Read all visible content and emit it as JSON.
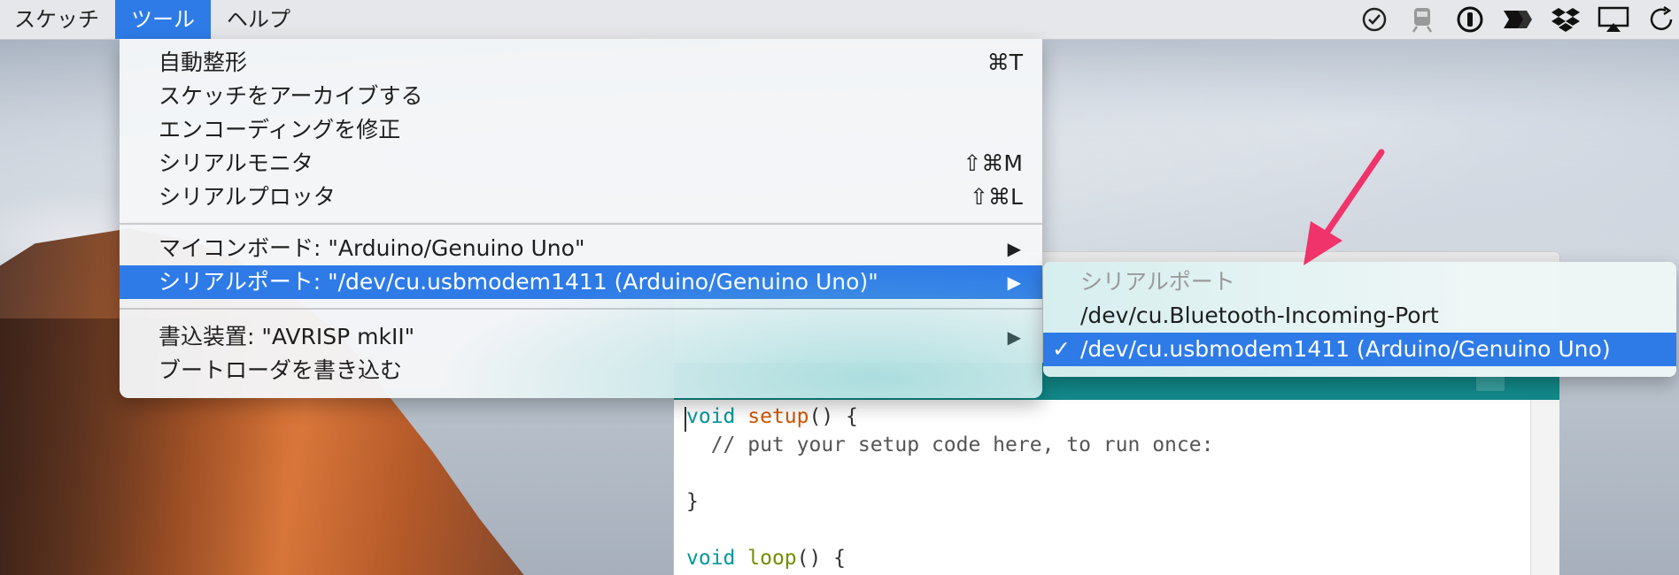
{
  "menubar": {
    "items": [
      {
        "label": "スケッチ"
      },
      {
        "label": "ツール"
      },
      {
        "label": "ヘルプ"
      }
    ],
    "status_icons": [
      "check-badge-icon",
      "train-icon",
      "one-password-icon",
      "arrows-icon",
      "dropbox-icon",
      "airplay-icon",
      "sync-icon"
    ]
  },
  "tools_menu": {
    "items": [
      {
        "label": "自動整形",
        "shortcut": "⌘T"
      },
      {
        "label": "スケッチをアーカイブする",
        "shortcut": ""
      },
      {
        "label": "エンコーディングを修正",
        "shortcut": ""
      },
      {
        "label": "シリアルモニタ",
        "shortcut": "⇧⌘M"
      },
      {
        "label": "シリアルプロッタ",
        "shortcut": "⇧⌘L"
      },
      {
        "label": "マイコンボード: \"Arduino/Genuino Uno\"",
        "submenu": true
      },
      {
        "label": "シリアルポート: \"/dev/cu.usbmodem1411 (Arduino/Genuino Uno)\"",
        "submenu": true
      },
      {
        "label": "書込装置: \"AVRISP mkII\"",
        "submenu": true
      },
      {
        "label": "ブートローダを書き込む",
        "submenu": false
      }
    ],
    "arrow_glyph": "▶"
  },
  "serial_submenu": {
    "header": "シリアルポート",
    "items": [
      {
        "label": "/dev/cu.Bluetooth-Incoming-Port",
        "checked": false
      },
      {
        "label": "/dev/cu.usbmodem1411 (Arduino/Genuino Uno)",
        "checked": true
      }
    ],
    "check_glyph": "✓"
  },
  "editor": {
    "lines": [
      {
        "kw": "void",
        "fn": "setup",
        "rest": "() {"
      },
      {
        "comment": "  // put your setup code here, to run once:"
      },
      {
        "text": "}"
      },
      {
        "kw": "void",
        "fn": "loop",
        "rest": "() {"
      }
    ]
  },
  "colors": {
    "highlight": "#2e7be8",
    "arrow": "#f0336a",
    "ide_teal": "#128a8a"
  }
}
